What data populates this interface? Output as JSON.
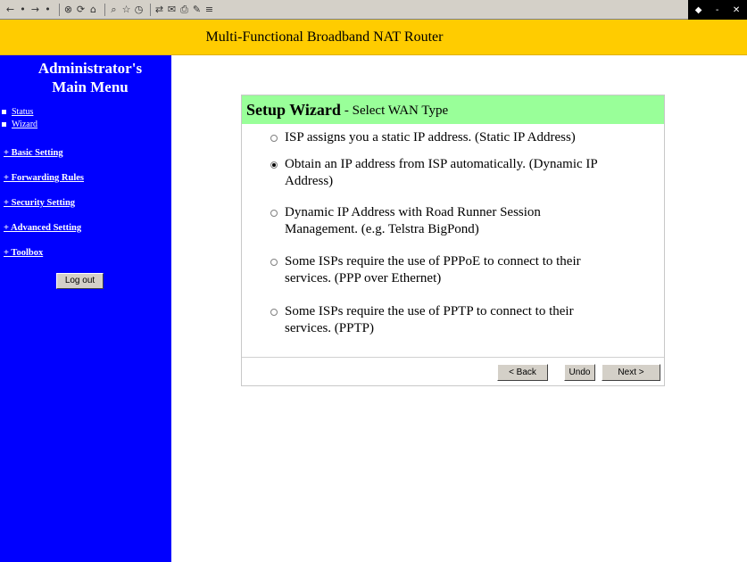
{
  "toolbar": {
    "icons": [
      "←",
      "•",
      "→",
      "•",
      "⊗",
      "⟳",
      "⌂",
      "⌕",
      "☆",
      "◷",
      "⇄",
      "✉",
      "⎙",
      "✎",
      "≡"
    ],
    "right_icons": [
      "◆",
      "-",
      "✕"
    ]
  },
  "header": {
    "title": "Multi-Functional Broadband NAT Router",
    "bg_color": "#ffcc00"
  },
  "sidebar": {
    "title_line1": "Administrator's",
    "title_line2": "Main Menu",
    "bg_color": "#0000ff",
    "top_links": [
      "Status",
      "Wizard"
    ],
    "sections": [
      "+ Basic Setting",
      "+ Forwarding Rules",
      "+ Security Setting",
      "+ Advanced Setting",
      "+ Toolbox"
    ],
    "logout_label": "Log out"
  },
  "wizard": {
    "title": "Setup Wizard",
    "subtitle": "- Select WAN Type",
    "head_color": "#99ff99",
    "options": [
      {
        "line1": "ISP assigns you a static IP address. (Static IP Address)",
        "line2": "",
        "selected": false
      },
      {
        "line1": "Obtain an IP address from ISP automatically. (Dynamic IP",
        "line2": "Address)",
        "selected": true
      },
      {
        "line1": "Dynamic IP Address with Road Runner Session",
        "line2": "Management. (e.g. Telstra BigPond)",
        "selected": false
      },
      {
        "line1": "Some ISPs require the use of PPPoE to connect to their",
        "line2": "services. (PPP over Ethernet)",
        "selected": false
      },
      {
        "line1": "Some ISPs require the use of PPTP to connect to their",
        "line2": "services. (PPTP)",
        "selected": false
      }
    ],
    "buttons": {
      "back": "< Back",
      "undo": "Undo",
      "next": "Next >"
    }
  }
}
